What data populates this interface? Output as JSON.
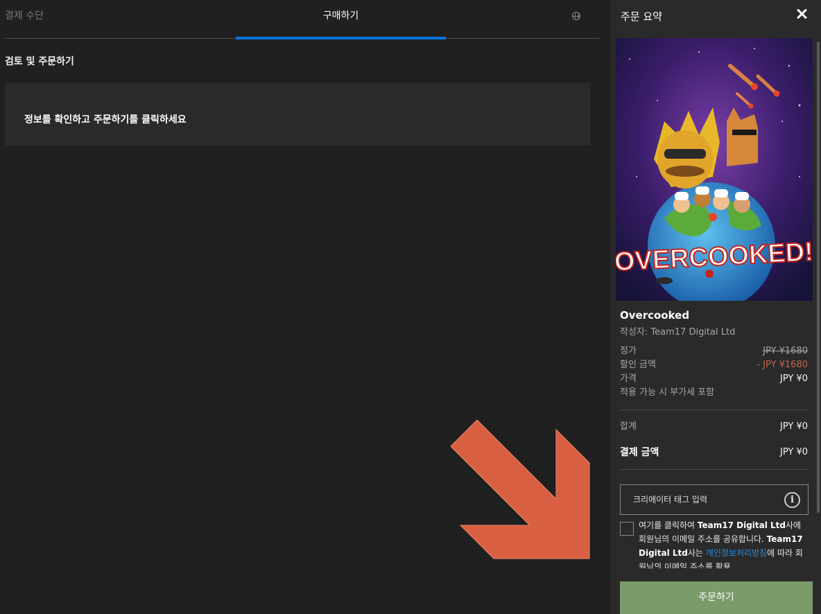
{
  "tabs": {
    "payment_label": "결제 수단",
    "purchase_label": "구매하기"
  },
  "main": {
    "section_title": "검토 및 주문하기",
    "info_text": "정보를 확인하고 주문하기를 클릭하세요"
  },
  "summary": {
    "title": "주문 요약",
    "game_title": "Overcooked",
    "publisher_label": "작성자:",
    "publisher_name": "Team17 Digital Ltd",
    "cover_logo_text": "OVERCOOKED!",
    "rows": {
      "list_price_label": "정가",
      "list_price_value": "JPY ¥1680",
      "discount_label": "할인 금액",
      "discount_value": "- JPY ¥1680",
      "price_label": "가격",
      "price_value": "JPY ¥0",
      "vat_note": "적용 가능 시 부가세 포함",
      "total_label": "합계",
      "total_value": "JPY ¥0",
      "payment_amount_label": "결제 금액",
      "payment_amount_value": "JPY ¥0"
    },
    "creator_tag_placeholder": "크리에이터 태그 입력",
    "consent": {
      "part1": "여기를 클릭하여 ",
      "company1": "Team17 Digital Ltd",
      "part2": "사에 회원님의 이메일 주소를 공유합니다. ",
      "company2": "Team17 Digital Ltd",
      "part3": "사는 ",
      "link": "개인정보처리방침",
      "part4": "에 따라 회원님의 이메일 주소를 활용"
    },
    "order_button": "주문하기"
  },
  "colors": {
    "accent_blue": "#0a74da",
    "order_button": "#7c9b6a",
    "discount": "#c9624a",
    "arrow": "#d95f42"
  }
}
